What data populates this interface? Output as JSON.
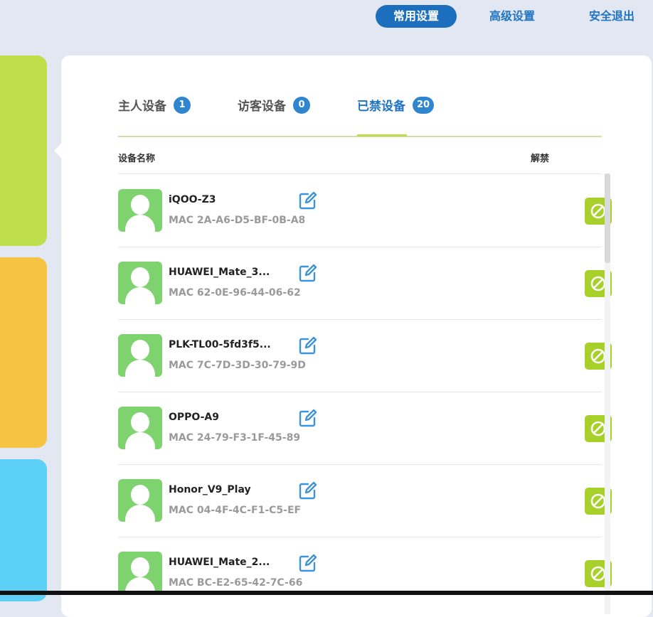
{
  "nav": {
    "dash": "-",
    "common_settings": "常用设置",
    "advanced_settings": "高级设置",
    "logout": "安全退出"
  },
  "tabs": [
    {
      "label": "主人设备",
      "count": "1"
    },
    {
      "label": "访客设备",
      "count": "0"
    },
    {
      "label": "已禁设备",
      "count": "20"
    }
  ],
  "active_tab": "已禁设备",
  "table": {
    "col_name": "设备名称",
    "col_action": "解禁"
  },
  "devices": [
    {
      "name": "iQOO-Z3",
      "mac": "MAC 2A-A6-D5-BF-0B-A8"
    },
    {
      "name": "HUAWEI_Mate_3...",
      "mac": "MAC 62-0E-96-44-06-62"
    },
    {
      "name": "PLK-TL00-5fd3f5...",
      "mac": "MAC 7C-7D-3D-30-79-9D"
    },
    {
      "name": "OPPO-A9",
      "mac": "MAC 24-79-F3-1F-45-89"
    },
    {
      "name": "Honor_V9_Play",
      "mac": "MAC 04-4F-4C-F1-C5-EF"
    },
    {
      "name": "HUAWEI_Mate_2...",
      "mac": "MAC BC-E2-65-42-7C-66"
    }
  ],
  "icons": {
    "edit": "edit-icon",
    "unblock": "unblock-icon",
    "avatar": "user-avatar-icon"
  },
  "colors": {
    "primary_blue": "#1c6fbd",
    "badge_blue": "#2f86cf",
    "accent_green": "#bede4b",
    "unblock_green": "#a8d02a",
    "avatar_green": "#7ed36e",
    "card_orange": "#f6c443",
    "card_cyan": "#5cd0f6"
  }
}
